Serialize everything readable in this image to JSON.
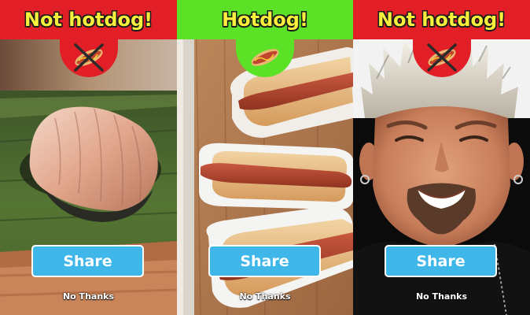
{
  "colors": {
    "negative": "#e21f26",
    "positive": "#5be125",
    "banner_text": "#f7ef3c",
    "share_button": "#3fb7e8"
  },
  "panels": [
    {
      "result_label": "Not hotdog!",
      "verdict": "not-hotdog",
      "badge_icon": "crossed-out-hotdog-icon",
      "photo": "sushi-photo",
      "share_label": "Share",
      "dismiss_label": "No Thanks"
    },
    {
      "result_label": "Hotdog!",
      "verdict": "hotdog",
      "badge_icon": "hotdog-icon",
      "photo": "hotdogs-photo",
      "share_label": "Share",
      "dismiss_label": "No Thanks"
    },
    {
      "result_label": "Not hotdog!",
      "verdict": "not-hotdog",
      "badge_icon": "crossed-out-hotdog-icon",
      "photo": "man-portrait-photo",
      "share_label": "Share",
      "dismiss_label": "No Thanks"
    }
  ]
}
